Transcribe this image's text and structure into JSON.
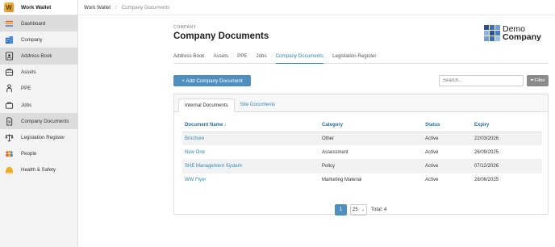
{
  "brand": {
    "name": "Work Wallet",
    "logo_letter": "W"
  },
  "sidebar": {
    "items": [
      {
        "label": "Dashboard",
        "icon": "dashboard-icon",
        "active": true
      },
      {
        "label": "Company",
        "icon": "company-icon",
        "active": false
      },
      {
        "label": "Address Book",
        "icon": "address-book-icon",
        "active": true
      },
      {
        "label": "Assets",
        "icon": "assets-icon",
        "active": false
      },
      {
        "label": "PPE",
        "icon": "ppe-icon",
        "active": false
      },
      {
        "label": "Jobs",
        "icon": "jobs-icon",
        "active": false
      },
      {
        "label": "Company Documents",
        "icon": "documents-icon",
        "active": true
      },
      {
        "label": "Legislation Register",
        "icon": "legislation-icon",
        "active": false
      },
      {
        "label": "People",
        "icon": "people-icon",
        "active": false
      },
      {
        "label": "Health & Safety",
        "icon": "health-safety-icon",
        "active": false
      }
    ]
  },
  "breadcrumb": {
    "root": "Work Wallet",
    "separator": "/",
    "current": "Company Documents"
  },
  "header": {
    "section": "COMPANY",
    "title": "Company Documents"
  },
  "company_logo": {
    "line1": "Demo",
    "line2": "Company",
    "colors": [
      "#2f4f8f",
      "#3a6fb5",
      "#6f9fd6",
      "#8fb3e0",
      "#2f4f8f",
      "#4a7fc0",
      "#6f9fd6",
      "#3a6fb5",
      "#9fc0e6"
    ]
  },
  "tabs": [
    {
      "label": "Address Book",
      "active": false
    },
    {
      "label": "Assets",
      "active": false
    },
    {
      "label": "PPE",
      "active": false
    },
    {
      "label": "Jobs",
      "active": false
    },
    {
      "label": "Company Documents",
      "active": true
    },
    {
      "label": "Legislation Register",
      "active": false
    }
  ],
  "toolbar": {
    "add_label": "+ Add Company Document",
    "search_placeholder": "Search...",
    "filter_label": "Filter"
  },
  "doc_tabs": [
    {
      "label": "Internal Documents",
      "active": true
    },
    {
      "label": "Site Documents",
      "active": false
    }
  ],
  "table": {
    "columns": [
      "Document Name ↓",
      "Category",
      "Status",
      "Expiry"
    ],
    "rows": [
      {
        "name": "Brochure",
        "category": "Other",
        "status": "Active",
        "expiry": "22/03/2026"
      },
      {
        "name": "New One",
        "category": "Assessment",
        "status": "Active",
        "expiry": "26/09/2025"
      },
      {
        "name": "SHE Management System",
        "category": "Policy",
        "status": "Active",
        "expiry": "07/12/2026"
      },
      {
        "name": "WW Flyer",
        "category": "Marketing Material",
        "status": "Active",
        "expiry": "28/06/2025"
      }
    ]
  },
  "pagination": {
    "current_page": "1",
    "page_size": "25",
    "total": "Total: 4"
  },
  "colors": {
    "accent": "#2a8ab4",
    "button": "#4f8fc0",
    "filter_button": "#8a8a8a",
    "sidebar_bg": "#f3f3f3",
    "active_bg": "#dcdcdc"
  }
}
